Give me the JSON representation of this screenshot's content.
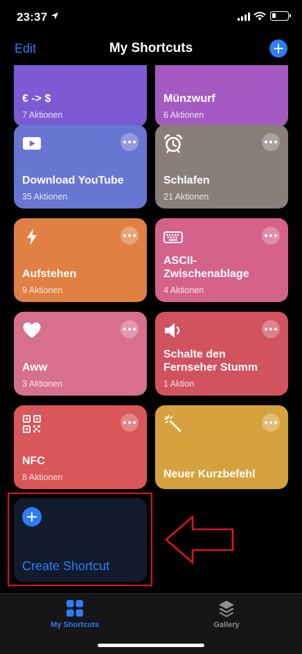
{
  "status": {
    "time": "23:37"
  },
  "nav": {
    "edit": "Edit",
    "title": "My Shortcuts"
  },
  "shortcuts": [
    {
      "title": "€ -> $",
      "subtitle": "7 Aktionen",
      "color": "#7b5ad3"
    },
    {
      "title": "Münzwurf",
      "subtitle": "6 Aktionen",
      "color": "#a45ac2"
    },
    {
      "title": "Download YouTube",
      "subtitle": "35 Aktionen",
      "icon": "play-video-icon",
      "color": "#6876d1"
    },
    {
      "title": "Schlafen",
      "subtitle": "21 Aktionen",
      "icon": "alarm-clock-icon",
      "color": "#8a7f78"
    },
    {
      "title": "Aufstehen",
      "subtitle": "9 Aktionen",
      "icon": "lightning-icon",
      "color": "#e08043"
    },
    {
      "title": "ASCII-Zwischenablage",
      "subtitle": "4 Aktionen",
      "icon": "keyboard-icon",
      "color": "#d4628a"
    },
    {
      "title": "Aww",
      "subtitle": "3 Aktionen",
      "icon": "heart-icon",
      "color": "#d7708d"
    },
    {
      "title": "Schalte den Fernseher Stumm",
      "subtitle": "1 Aktion",
      "icon": "speaker-mute-icon",
      "color": "#d1535f"
    },
    {
      "title": "NFC",
      "subtitle": "8 Aktionen",
      "icon": "qr-code-icon",
      "color": "#d95659"
    },
    {
      "title": "Neuer Kurzbefehl",
      "icon": "magic-wand-icon",
      "color": "#d6a23d"
    }
  ],
  "create": {
    "label": "Create Shortcut"
  },
  "tabs": [
    {
      "label": "My Shortcuts",
      "icon": "grid-icon",
      "active": true
    },
    {
      "label": "Gallery",
      "icon": "layers-icon",
      "active": false
    }
  ],
  "colors": {
    "accent": "#2f7cf6",
    "annotation": "#e0131b"
  }
}
